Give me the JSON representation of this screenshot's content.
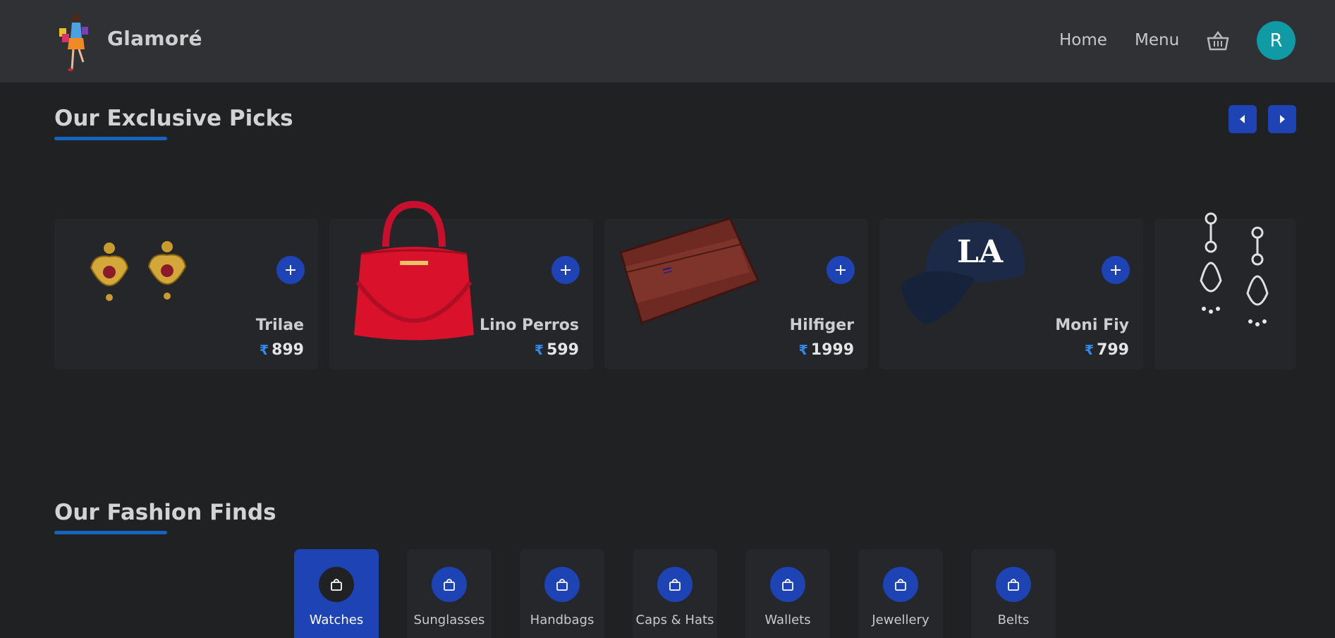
{
  "header": {
    "brand": "Glamoré",
    "nav": {
      "home": "Home",
      "menu": "Menu"
    },
    "avatar_initial": "R"
  },
  "exclusive": {
    "title": "Our Exclusive Picks",
    "products": [
      {
        "name": "Trilae",
        "currency": "₹",
        "price": "899"
      },
      {
        "name": "Lino Perros",
        "currency": "₹",
        "price": "599"
      },
      {
        "name": "Hilfiger",
        "currency": "₹",
        "price": "1999"
      },
      {
        "name": "Moni Fiy",
        "currency": "₹",
        "price": "799"
      }
    ]
  },
  "fashion": {
    "title": "Our Fashion Finds",
    "categories": [
      {
        "label": "Watches",
        "active": true
      },
      {
        "label": "Sunglasses"
      },
      {
        "label": "Handbags"
      },
      {
        "label": "Caps & Hats"
      },
      {
        "label": "Wallets"
      },
      {
        "label": "Jewellery"
      },
      {
        "label": "Belts"
      }
    ]
  },
  "colors": {
    "accent": "#1d43b5",
    "avatar": "#0f9aa6",
    "background": "#1f2123",
    "header": "#2f3134",
    "underline": "#1565c0"
  }
}
